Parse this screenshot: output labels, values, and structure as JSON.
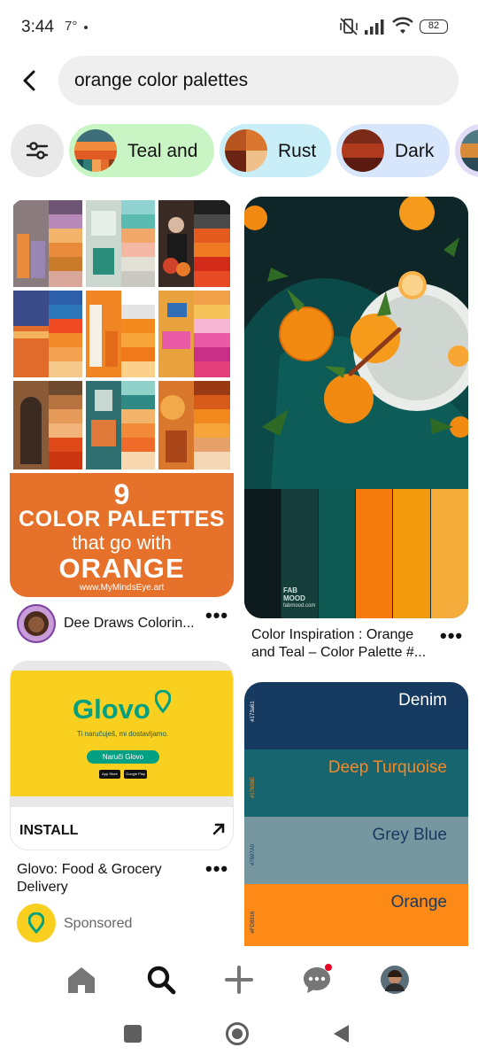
{
  "status_bar": {
    "time": "3:44",
    "temp": "7°",
    "battery": "82"
  },
  "search": {
    "query": "orange color palettes"
  },
  "chips": [
    {
      "label": "Teal and",
      "bg": "#c9f5c4"
    },
    {
      "label": "Rust",
      "bg": "#c9eef8"
    },
    {
      "label": "Dark",
      "bg": "#d7e6fb"
    }
  ],
  "pins": {
    "collage": {
      "banner_number": "9",
      "banner_line1": "COLOR PALETTES",
      "banner_line2": "that go with",
      "banner_line3": "ORANGE",
      "banner_url": "www.MyMindsEye.art",
      "author": "Dee Draws Colorin..."
    },
    "teal": {
      "watermark_line1": "FAB",
      "watermark_line2": "MOOD",
      "watermark_url": "fabmood.com",
      "title_line1": "Color Inspiration : Orange",
      "title_line2": "and Teal – Color Palette #...",
      "swatches": [
        "#0e1b1e",
        "#163e3a",
        "#0e5a52",
        "#f47b0c",
        "#f19a0e",
        "#f4ad3a"
      ]
    },
    "ad": {
      "brand": "Glovo",
      "tagline": "Ti naručuješ, mi dostavljamo.",
      "cta": "Naruči Glovo",
      "store1": "App Store",
      "store2": "Google Play",
      "install": "INSTALL",
      "title_line1": "Glovo: Food & Grocery",
      "title_line2": "Delivery",
      "sponsored": "Sponsored"
    },
    "palette": {
      "rows": [
        {
          "name": "Denim",
          "code": "#173a61",
          "bg": "#173a61",
          "fg": "#ffffff"
        },
        {
          "name": "Deep Turquoise",
          "code": "#17656E",
          "bg": "#17656e",
          "fg": "#f28a2a"
        },
        {
          "name": "Grey Blue",
          "code": "#7697A0",
          "bg": "#7697a0",
          "fg": "#173a61"
        },
        {
          "name": "Orange",
          "code": "#FD8916",
          "bg": "#fd8916",
          "fg": "#173a61"
        }
      ]
    }
  },
  "bottom_nav": [
    "home-icon",
    "search-icon",
    "plus-icon",
    "messages-icon",
    "profile-avatar"
  ],
  "system_nav": [
    "recents-icon",
    "home-circle-icon",
    "back-triangle-icon"
  ]
}
